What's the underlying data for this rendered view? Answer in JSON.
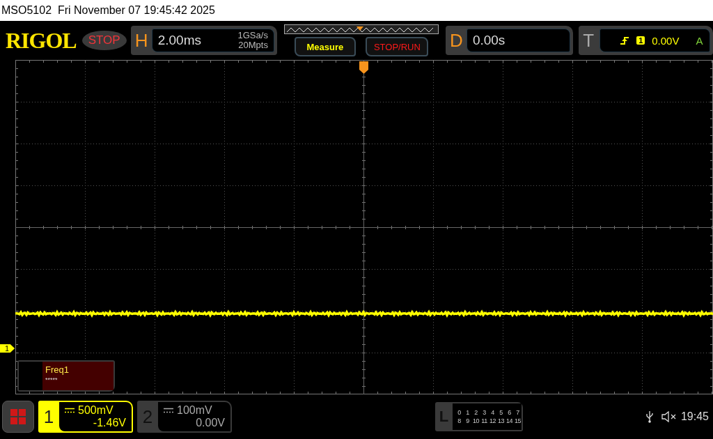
{
  "title_bar": {
    "title": "MSO5102  Fri November 07 19:45:42 2025"
  },
  "header": {
    "logo": "RIGOL",
    "run_state": {
      "label": "STOP",
      "running": false
    },
    "horizontal": {
      "letter": "H",
      "timebase": "2.00ms",
      "sample_rate": "1GSa/s",
      "memory_depth": "20Mpts"
    },
    "buttons": [
      {
        "label": "Measure",
        "kind": "measure"
      },
      {
        "label": "STOP/RUN",
        "kind": "run_control"
      }
    ],
    "delay": {
      "letter": "D",
      "value": "0.00s"
    },
    "trigger": {
      "letter": "T",
      "source": "1",
      "level": "0.00V",
      "mode": "A"
    }
  },
  "display": {
    "channel_marker": "1",
    "measurement": {
      "name": "Freq1",
      "value": "*****"
    }
  },
  "bottom_bar": {
    "channels": [
      {
        "label": "1",
        "scale": "500mV",
        "offset": "-1.46V",
        "active": true
      },
      {
        "label": "2",
        "scale": "100mV",
        "offset": "0.00V",
        "active": false
      }
    ],
    "logic": {
      "letter": "L",
      "rows": [
        [
          "0",
          "1",
          "2",
          "3",
          "4",
          "5",
          "6",
          "7"
        ],
        [
          "8",
          "9",
          "10",
          "11",
          "12",
          "13",
          "14",
          "15"
        ]
      ]
    },
    "time": "19:45"
  }
}
